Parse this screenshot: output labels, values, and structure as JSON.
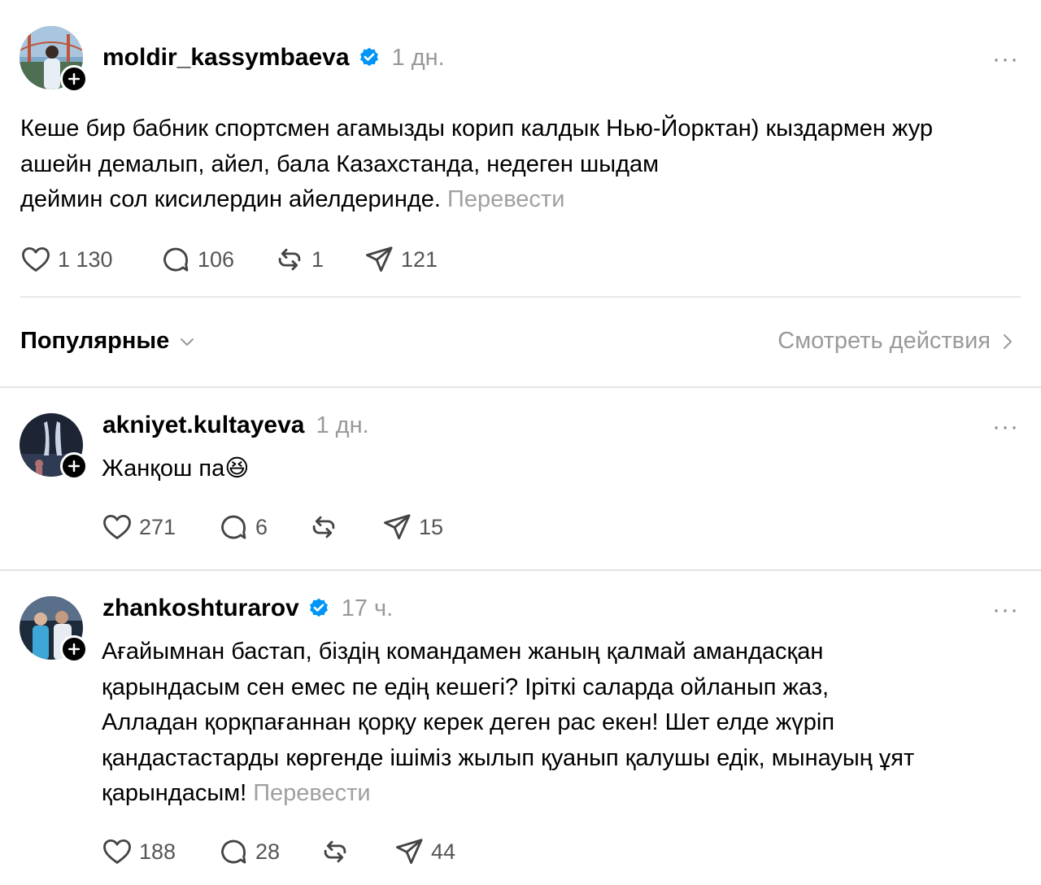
{
  "main_post": {
    "username": "moldir_kassymbaeva",
    "verified": true,
    "time": "1 дн.",
    "lines": [
      "Кеше бир бабник спортсмен агамызды корип калдык Нью-Йорктан) кыздармен жур",
      "ашейн демалып, айел, бала Казахстанда, недеген шыдам",
      "деймин сол кисилердин айелдеринде."
    ],
    "translate": "Перевести",
    "likes": "1 130",
    "comments": "106",
    "reposts": "1",
    "shares": "121"
  },
  "sort": {
    "label": "Популярные",
    "activity": "Смотреть действия"
  },
  "replies": [
    {
      "username": "akniyet.kultayeva",
      "verified": false,
      "time": "1 дн.",
      "text": "Жанқош па",
      "emoji": "😆",
      "likes": "271",
      "comments": "6",
      "reposts": "",
      "shares": "15"
    },
    {
      "username": "zhankoshturarov",
      "verified": true,
      "time": "17 ч.",
      "lines": [
        "Ағайымнан бастап, біздің командамен жаның қалмай амандасқан",
        "қарындасым сен емес пе едің кешегі? Іріткі саларда ойланып жаз,",
        "Алладан қорқпағаннан қорқу керек деген рас екен! Шет елде жүріп",
        "қандастастарды көргенде ішіміз жылып қуанып қалушы едік, мынауың ұят",
        "қарындасым!"
      ],
      "translate": "Перевести",
      "likes": "188",
      "comments": "28",
      "reposts": "",
      "shares": "44"
    }
  ],
  "colors": {
    "verified": "#0095f6",
    "muted": "#999999"
  }
}
